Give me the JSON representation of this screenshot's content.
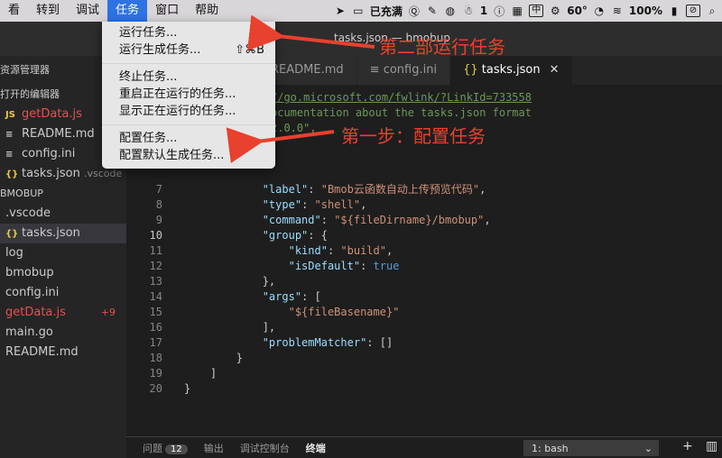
{
  "menubar": {
    "items": [
      "看",
      "转到",
      "调试",
      "任务",
      "窗口",
      "帮助"
    ],
    "active_index": 3,
    "status": {
      "charge": "已充满",
      "notif_count": "1",
      "ime": "中",
      "temperature": "60°",
      "battery": "100%"
    }
  },
  "window": {
    "title": "tasks.json — bmobup"
  },
  "sidebar": {
    "explorer_title": "资源管理器",
    "open_editors_title": "打开的编辑器",
    "open_editors": [
      {
        "icon": "JS",
        "name": "getData.js",
        "hint": ""
      },
      {
        "icon": "≡",
        "name": "README.md",
        "hint": ""
      },
      {
        "icon": "≡",
        "name": "config.ini",
        "hint": ""
      },
      {
        "icon": "{}",
        "name": "tasks.json",
        "hint": ".vscode"
      }
    ],
    "folder_title": "BMOBUP",
    "files": [
      {
        "name": ".vscode"
      },
      {
        "icon": "{}",
        "name": "tasks.json"
      },
      {
        "name": "log"
      },
      {
        "name": "bmobup"
      },
      {
        "name": "config.ini"
      },
      {
        "name": "getData.js",
        "badge": "+9"
      },
      {
        "name": "main.go"
      },
      {
        "name": "README.md"
      }
    ]
  },
  "tabs": [
    {
      "label": "README.md"
    },
    {
      "icon": "≡",
      "label": "config.ini"
    },
    {
      "icon": "{}",
      "label": "tasks.json",
      "close": "✕"
    }
  ],
  "editor": {
    "lines": [
      {
        "n": "",
        "comment_tail": "//go.microsoft.com/fwlink/?LinkId=733558"
      },
      {
        "n": "",
        "comment_tail": "ocumentation about the tasks.json format"
      },
      {
        "n": "",
        "comment_tail": "2.0.0\","
      },
      {
        "n": ""
      },
      {
        "n": ""
      },
      {
        "n": ""
      },
      {
        "n": "7",
        "key": "\"label\"",
        "val": "\"Bmob云函数自动上传预览代码\""
      },
      {
        "n": "8",
        "key": "\"type\"",
        "val": "\"shell\""
      },
      {
        "n": "9",
        "key": "\"command\"",
        "val": "\"${fileDirname}/bmobup\""
      },
      {
        "n": "10",
        "key": "\"group\"",
        "punct": ": {"
      },
      {
        "n": "11",
        "key": "\"kind\"",
        "val": "\"build\""
      },
      {
        "n": "12",
        "key": "\"isDefault\"",
        "bool": "true"
      },
      {
        "n": "13",
        "punct": "},"
      },
      {
        "n": "14",
        "key": "\"args\"",
        "punct": ": ["
      },
      {
        "n": "15",
        "val": "\"${fileBasename}\""
      },
      {
        "n": "16",
        "punct": "],"
      },
      {
        "n": "17",
        "key": "\"problemMatcher\"",
        "punct": ": []"
      },
      {
        "n": "18",
        "punct": "}"
      },
      {
        "n": "19",
        "punct": "]"
      },
      {
        "n": "20",
        "punct": "}"
      }
    ],
    "current_line": "10"
  },
  "panel": {
    "tabs": [
      "问题",
      "输出",
      "调试控制台",
      "终端"
    ],
    "problems_count": "12",
    "active_tab": "终端",
    "terminal_select": "1: bash",
    "add_btn": "+",
    "split_btn": "▥"
  },
  "task_menu": {
    "items": [
      {
        "label": "运行任务...",
        "shortcut": ""
      },
      {
        "label": "运行生成任务...",
        "shortcut": "⇧⌘B"
      },
      {
        "label": "终止任务...",
        "shortcut": ""
      },
      {
        "label": "重启正在运行的任务...",
        "shortcut": ""
      },
      {
        "label": "显示正在运行的任务...",
        "shortcut": ""
      },
      {
        "label": "配置任务...",
        "shortcut": ""
      },
      {
        "label": "配置默认生成任务...",
        "shortcut": ""
      }
    ]
  },
  "annotations": {
    "step2": "第二部运行任务",
    "step1": "第一步：配置任务"
  },
  "colors": {
    "accent": "#2d73e6",
    "annotation": "#e8412e",
    "editor_bg": "#1e1e1e"
  }
}
